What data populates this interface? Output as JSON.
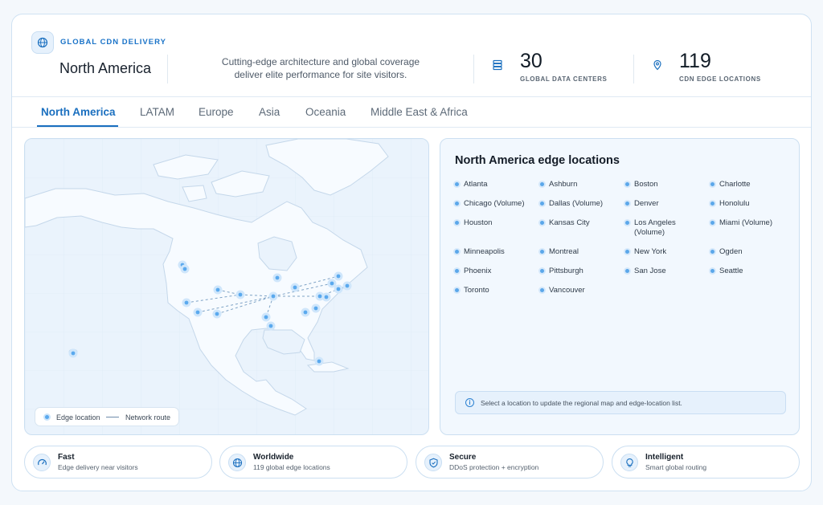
{
  "header": {
    "brand_label": "GLOBAL CDN DELIVERY",
    "region_title": "North America",
    "tagline": "Cutting-edge architecture and global coverage deliver elite performance for site visitors.",
    "stats": [
      {
        "value": "30",
        "label": "GLOBAL DATA CENTERS",
        "icon": "server-icon"
      },
      {
        "value": "119",
        "label": "CDN EDGE LOCATIONS",
        "icon": "map-pin-icon"
      }
    ]
  },
  "tabs": [
    {
      "label": "North America",
      "active": true
    },
    {
      "label": "LATAM",
      "active": false
    },
    {
      "label": "Europe",
      "active": false
    },
    {
      "label": "Asia",
      "active": false
    },
    {
      "label": "Oceania",
      "active": false
    },
    {
      "label": "Middle East & Africa",
      "active": false
    }
  ],
  "map": {
    "legend": {
      "edge_label": "Edge location",
      "route_label": "Network route"
    }
  },
  "locations": {
    "title": "North America edge locations",
    "items": [
      "Atlanta",
      "Ashburn",
      "Boston",
      "Charlotte",
      "Chicago (Volume)",
      "Dallas (Volume)",
      "Denver",
      "Honolulu",
      "Houston",
      "Kansas City",
      "Los Angeles (Volume)",
      "Miami (Volume)",
      "Minneapolis",
      "Montreal",
      "New York",
      "Ogden",
      "Phoenix",
      "Pittsburgh",
      "San Jose",
      "Seattle",
      "Toronto",
      "Vancouver"
    ],
    "hint": "Select a location to update the regional map and edge-location list."
  },
  "features": [
    {
      "title": "Fast",
      "subtitle": "Edge delivery near visitors",
      "icon": "speedometer-icon"
    },
    {
      "title": "Worldwide",
      "subtitle": "119 global edge locations",
      "icon": "globe-icon"
    },
    {
      "title": "Secure",
      "subtitle": "DDoS protection + encryption",
      "icon": "shield-icon"
    },
    {
      "title": "Intelligent",
      "subtitle": "Smart global routing",
      "icon": "lightbulb-icon"
    }
  ],
  "colors": {
    "accent": "#1a6fbf",
    "dot": "#5aa9ee",
    "land": "#f7fbff",
    "water": "#eaf3fc"
  }
}
